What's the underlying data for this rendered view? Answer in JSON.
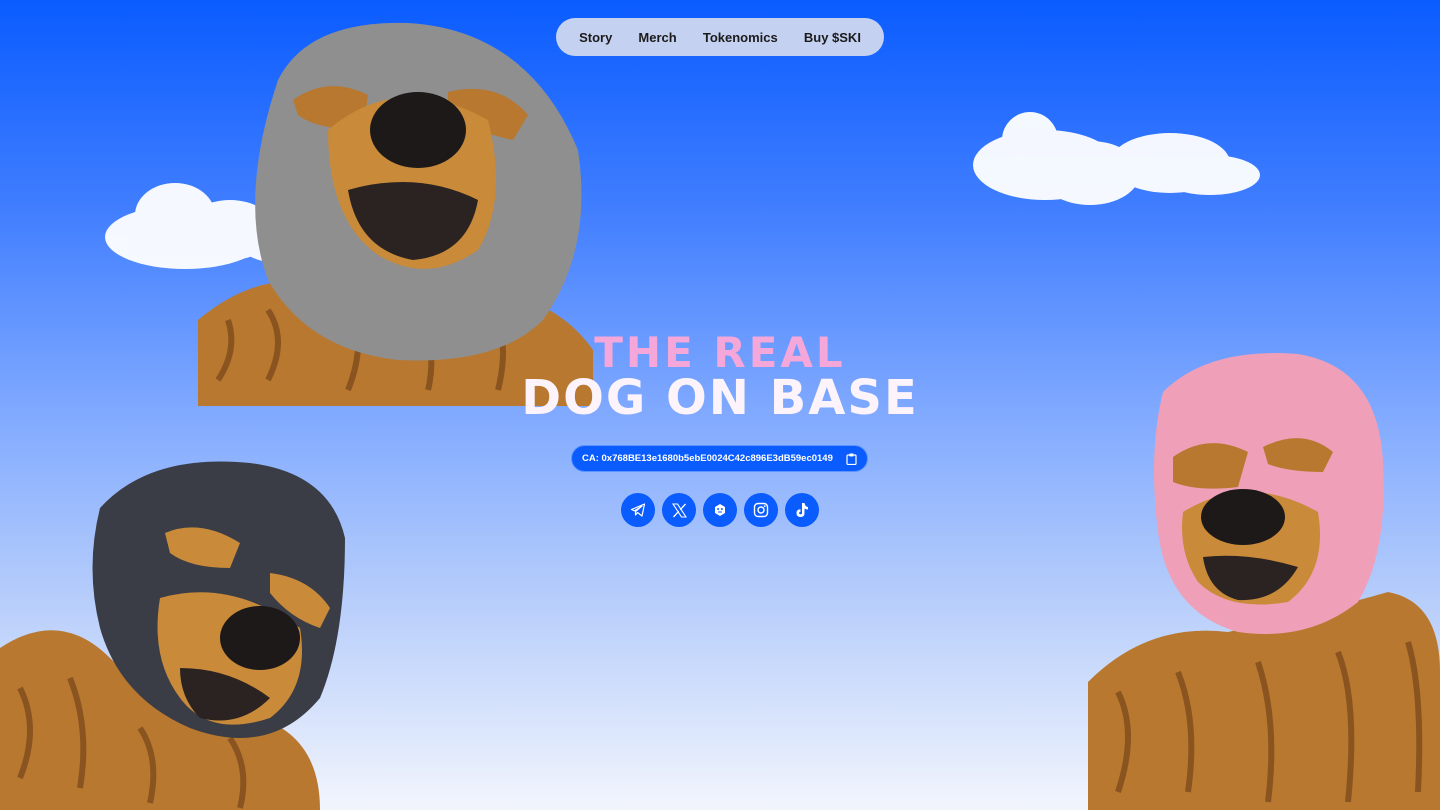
{
  "nav": {
    "items": [
      {
        "label": "Story"
      },
      {
        "label": "Merch"
      },
      {
        "label": "Tokenomics"
      },
      {
        "label": "Buy $SKI"
      }
    ]
  },
  "hero": {
    "title_line1": "THE REAL",
    "title_line2": "DOG ON BASE",
    "contract_address": "CA: 0x768BE13e1680b5ebE0024C42c896E3dB59ec0149",
    "copy_icon": "clipboard-icon"
  },
  "socials": [
    {
      "icon": "telegram-icon"
    },
    {
      "icon": "x-icon"
    },
    {
      "icon": "token-icon"
    },
    {
      "icon": "instagram-icon"
    },
    {
      "icon": "tiktok-icon"
    }
  ],
  "colors": {
    "sky_top": "#0a5cff",
    "sky_bottom": "#f2f5fc",
    "accent": "#0a5cff",
    "nav_bg": "#c5d1f1",
    "title_pink": "#f5a7da",
    "title_white": "#fdf3fb",
    "mask_gray": "#8f8f8f",
    "mask_black": "#3a3d45",
    "mask_pink": "#efa0b8",
    "fur": "#b9782f"
  }
}
